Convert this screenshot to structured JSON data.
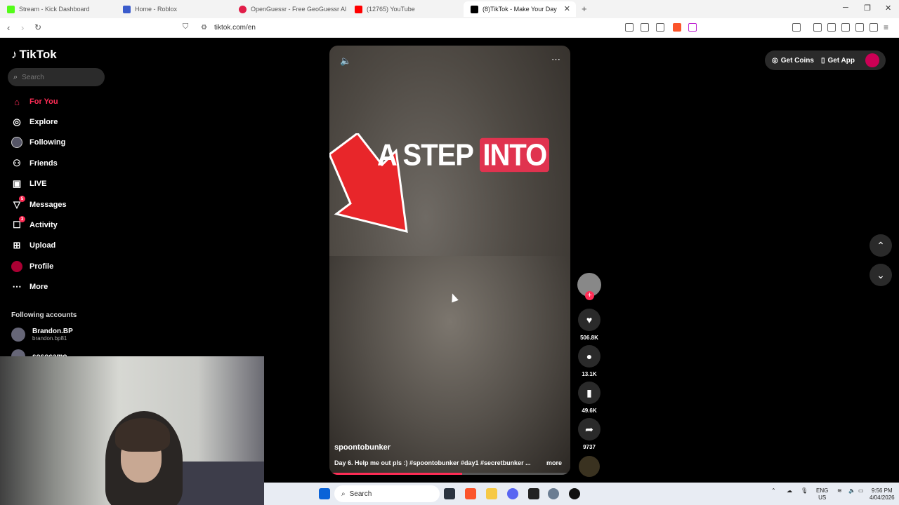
{
  "browser": {
    "tabs": [
      {
        "label": "Stream - Kick Dashboard",
        "color": "#53fc18"
      },
      {
        "label": "Home - Roblox",
        "color": "#3b5ccc"
      },
      {
        "label": "OpenGuessr - Free GeoGuessr Al",
        "color": "#e11d48"
      },
      {
        "label": "(12765) YouTube",
        "color": "#ff0000"
      },
      {
        "label": "(8)TikTok - Make Your Day",
        "color": "#000000"
      }
    ],
    "new_tab": "+",
    "url": "tiktok.com/en"
  },
  "sidebar": {
    "logo": "TikTok",
    "search_placeholder": "Search",
    "nav": [
      {
        "label": "For You",
        "icon": "home-icon"
      },
      {
        "label": "Explore",
        "icon": "compass-icon"
      },
      {
        "label": "Following",
        "icon": "following-icon"
      },
      {
        "label": "Friends",
        "icon": "friends-icon"
      },
      {
        "label": "LIVE",
        "icon": "live-icon"
      },
      {
        "label": "Messages",
        "icon": "messages-icon",
        "badge": "5"
      },
      {
        "label": "Activity",
        "icon": "activity-icon",
        "badge": "3"
      },
      {
        "label": "Upload",
        "icon": "upload-icon"
      },
      {
        "label": "Profile",
        "icon": "profile-icon"
      },
      {
        "label": "More",
        "icon": "more-icon"
      }
    ],
    "following_title": "Following accounts",
    "accounts": [
      {
        "name": "Brandon.BP",
        "handle": "brandon.bp81"
      },
      {
        "name": "sosocamo",
        "handle": ""
      }
    ]
  },
  "video": {
    "overlay_text_1": "A STEP ",
    "overlay_text_2": "INTO",
    "author": "spoontobunker",
    "caption": "Day 6. Help me out pls :) #spoontobunker #day1 #secretbunker ...",
    "more": "more",
    "progress": 0.55
  },
  "actions": {
    "likes": "506.8K",
    "comments": "13.1K",
    "saves": "49.6K",
    "shares": "9737"
  },
  "top": {
    "get_coins": "Get Coins",
    "get_app": "Get App"
  },
  "taskbar": {
    "search": "Search",
    "lang_1": "ENG",
    "lang_2": "US",
    "time": "9:56 PM",
    "date": "4/04/2026"
  }
}
